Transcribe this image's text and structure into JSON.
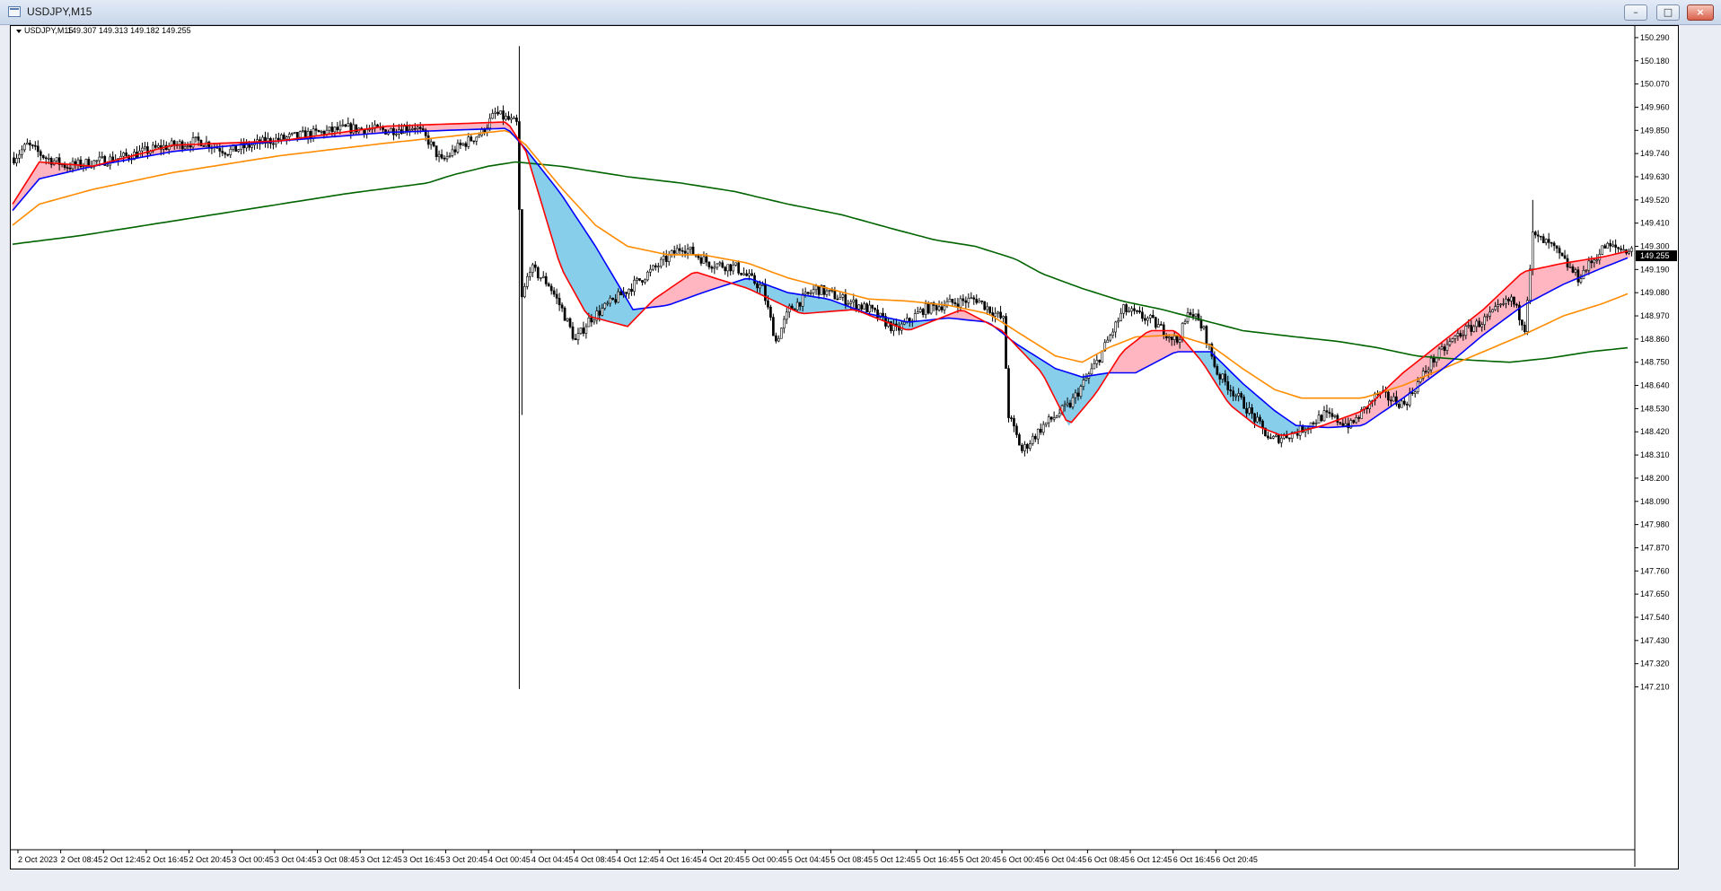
{
  "window": {
    "title": "USDJPY,M15",
    "buttons": {
      "minimize": "–",
      "maximize": "□",
      "close": "×"
    }
  },
  "chart_info": {
    "symbol_label": "USDJPY,M15",
    "ohlc": "149.307 149.313 149.182 149.255",
    "current_price": "149.255"
  },
  "colors": {
    "background": "#ffffff",
    "candle": "#000000",
    "ma_red": "#ff0000",
    "ma_blue": "#0000ff",
    "ma_orange": "#ff8c00",
    "ma_green": "#006400",
    "fill_bull": "#ffb6c1",
    "fill_bear": "#87ceeb"
  },
  "chart_data": {
    "type": "candlestick",
    "ylim": [
      147.11,
      150.345
    ],
    "y_ticks": [
      "150.290",
      "150.180",
      "150.070",
      "149.960",
      "149.850",
      "149.740",
      "149.630",
      "149.520",
      "149.410",
      "149.300",
      "149.190",
      "149.080",
      "148.970",
      "148.860",
      "148.750",
      "148.640",
      "148.530",
      "148.420",
      "148.310",
      "148.200",
      "148.090",
      "147.980",
      "147.870",
      "147.760",
      "147.650",
      "147.540",
      "147.430",
      "147.320",
      "147.210"
    ],
    "x_ticks": [
      "2 Oct 2023",
      "2 Oct 08:45",
      "2 Oct 12:45",
      "2 Oct 16:45",
      "2 Oct 20:45",
      "3 Oct 00:45",
      "3 Oct 04:45",
      "3 Oct 08:45",
      "3 Oct 12:45",
      "3 Oct 16:45",
      "3 Oct 20:45",
      "4 Oct 00:45",
      "4 Oct 04:45",
      "4 Oct 08:45",
      "4 Oct 12:45",
      "4 Oct 16:45",
      "4 Oct 20:45",
      "5 Oct 00:45",
      "5 Oct 04:45",
      "5 Oct 08:45",
      "5 Oct 12:45",
      "5 Oct 16:45",
      "5 Oct 20:45",
      "6 Oct 00:45",
      "6 Oct 04:45",
      "6 Oct 08:45",
      "6 Oct 12:45",
      "6 Oct 16:45",
      "6 Oct 20:45"
    ],
    "bars_per_tick": 16,
    "close_path": [
      [
        0,
        149.72
      ],
      [
        5,
        149.78
      ],
      [
        12,
        149.72
      ],
      [
        20,
        149.68
      ],
      [
        30,
        149.7
      ],
      [
        40,
        149.72
      ],
      [
        55,
        149.77
      ],
      [
        70,
        149.8
      ],
      [
        80,
        149.75
      ],
      [
        95,
        149.8
      ],
      [
        110,
        149.83
      ],
      [
        125,
        149.86
      ],
      [
        140,
        149.85
      ],
      [
        150,
        149.87
      ],
      [
        155,
        149.8
      ],
      [
        160,
        149.7
      ],
      [
        165,
        149.76
      ],
      [
        175,
        149.84
      ],
      [
        180,
        149.93
      ],
      [
        185,
        149.9
      ],
      [
        188,
        149.88
      ],
      [
        190,
        149.05
      ],
      [
        193,
        149.2
      ],
      [
        200,
        149.12
      ],
      [
        205,
        149.0
      ],
      [
        210,
        148.85
      ],
      [
        215,
        148.95
      ],
      [
        220,
        149.0
      ],
      [
        230,
        149.1
      ],
      [
        240,
        149.2
      ],
      [
        250,
        149.3
      ],
      [
        260,
        149.22
      ],
      [
        270,
        149.2
      ],
      [
        280,
        149.1
      ],
      [
        285,
        148.85
      ],
      [
        290,
        149.0
      ],
      [
        300,
        149.1
      ],
      [
        310,
        149.05
      ],
      [
        320,
        149.0
      ],
      [
        330,
        148.9
      ],
      [
        340,
        149.0
      ],
      [
        350,
        149.03
      ],
      [
        360,
        149.05
      ],
      [
        370,
        148.95
      ],
      [
        372,
        148.5
      ],
      [
        377,
        148.33
      ],
      [
        385,
        148.45
      ],
      [
        395,
        148.55
      ],
      [
        405,
        148.75
      ],
      [
        415,
        149.0
      ],
      [
        425,
        148.95
      ],
      [
        435,
        148.85
      ],
      [
        440,
        149.0
      ],
      [
        445,
        148.9
      ],
      [
        450,
        148.7
      ],
      [
        460,
        148.55
      ],
      [
        470,
        148.38
      ],
      [
        480,
        148.42
      ],
      [
        490,
        148.5
      ],
      [
        500,
        148.45
      ],
      [
        510,
        148.6
      ],
      [
        520,
        148.55
      ],
      [
        530,
        148.75
      ],
      [
        540,
        148.88
      ],
      [
        550,
        148.95
      ],
      [
        560,
        149.05
      ],
      [
        565,
        148.92
      ],
      [
        568,
        149.35
      ],
      [
        575,
        149.3
      ],
      [
        585,
        149.15
      ],
      [
        595,
        149.3
      ],
      [
        605,
        149.28
      ]
    ],
    "ma_red": [
      [
        0,
        149.5
      ],
      [
        10,
        149.7
      ],
      [
        30,
        149.68
      ],
      [
        60,
        149.78
      ],
      [
        100,
        149.8
      ],
      [
        140,
        149.87
      ],
      [
        185,
        149.89
      ],
      [
        192,
        149.75
      ],
      [
        205,
        149.2
      ],
      [
        215,
        148.97
      ],
      [
        230,
        148.92
      ],
      [
        240,
        149.05
      ],
      [
        255,
        149.18
      ],
      [
        275,
        149.1
      ],
      [
        295,
        148.98
      ],
      [
        315,
        149.0
      ],
      [
        335,
        148.9
      ],
      [
        355,
        149.0
      ],
      [
        370,
        148.9
      ],
      [
        385,
        148.7
      ],
      [
        395,
        148.45
      ],
      [
        405,
        148.6
      ],
      [
        415,
        148.8
      ],
      [
        425,
        148.9
      ],
      [
        435,
        148.9
      ],
      [
        445,
        148.75
      ],
      [
        455,
        148.55
      ],
      [
        465,
        148.45
      ],
      [
        475,
        148.4
      ],
      [
        490,
        148.45
      ],
      [
        505,
        148.52
      ],
      [
        520,
        148.7
      ],
      [
        535,
        148.85
      ],
      [
        550,
        149.0
      ],
      [
        565,
        149.18
      ],
      [
        580,
        149.22
      ],
      [
        595,
        149.25
      ],
      [
        605,
        149.28
      ]
    ],
    "ma_blue": [
      [
        0,
        149.47
      ],
      [
        10,
        149.62
      ],
      [
        30,
        149.68
      ],
      [
        60,
        149.75
      ],
      [
        100,
        149.8
      ],
      [
        140,
        149.84
      ],
      [
        185,
        149.86
      ],
      [
        192,
        149.76
      ],
      [
        205,
        149.55
      ],
      [
        218,
        149.3
      ],
      [
        232,
        149.0
      ],
      [
        245,
        149.02
      ],
      [
        258,
        149.08
      ],
      [
        275,
        149.15
      ],
      [
        290,
        149.08
      ],
      [
        305,
        149.05
      ],
      [
        320,
        148.98
      ],
      [
        335,
        148.94
      ],
      [
        350,
        148.96
      ],
      [
        365,
        148.94
      ],
      [
        375,
        148.84
      ],
      [
        390,
        148.72
      ],
      [
        400,
        148.68
      ],
      [
        410,
        148.7
      ],
      [
        420,
        148.7
      ],
      [
        435,
        148.8
      ],
      [
        448,
        148.8
      ],
      [
        460,
        148.65
      ],
      [
        472,
        148.52
      ],
      [
        480,
        148.45
      ],
      [
        492,
        148.44
      ],
      [
        505,
        148.45
      ],
      [
        520,
        148.58
      ],
      [
        535,
        148.72
      ],
      [
        550,
        148.88
      ],
      [
        565,
        149.02
      ],
      [
        580,
        149.12
      ],
      [
        595,
        149.2
      ],
      [
        605,
        149.25
      ]
    ],
    "ma_orange": [
      [
        0,
        149.4
      ],
      [
        10,
        149.5
      ],
      [
        30,
        149.57
      ],
      [
        60,
        149.65
      ],
      [
        100,
        149.73
      ],
      [
        140,
        149.79
      ],
      [
        185,
        149.85
      ],
      [
        192,
        149.78
      ],
      [
        205,
        149.58
      ],
      [
        218,
        149.4
      ],
      [
        230,
        149.3
      ],
      [
        245,
        149.26
      ],
      [
        258,
        149.26
      ],
      [
        275,
        149.22
      ],
      [
        290,
        149.15
      ],
      [
        305,
        149.1
      ],
      [
        320,
        149.05
      ],
      [
        335,
        149.04
      ],
      [
        350,
        149.02
      ],
      [
        365,
        148.98
      ],
      [
        375,
        148.9
      ],
      [
        390,
        148.78
      ],
      [
        400,
        148.75
      ],
      [
        410,
        148.82
      ],
      [
        420,
        148.87
      ],
      [
        435,
        148.88
      ],
      [
        448,
        148.83
      ],
      [
        460,
        148.72
      ],
      [
        472,
        148.62
      ],
      [
        482,
        148.58
      ],
      [
        495,
        148.58
      ],
      [
        505,
        148.58
      ],
      [
        520,
        148.64
      ],
      [
        535,
        148.72
      ],
      [
        550,
        148.8
      ],
      [
        565,
        148.88
      ],
      [
        580,
        148.97
      ],
      [
        595,
        149.03
      ],
      [
        605,
        149.08
      ]
    ],
    "ma_green": [
      [
        0,
        149.31
      ],
      [
        25,
        149.35
      ],
      [
        50,
        149.4
      ],
      [
        75,
        149.45
      ],
      [
        100,
        149.5
      ],
      [
        125,
        149.55
      ],
      [
        155,
        149.6
      ],
      [
        165,
        149.64
      ],
      [
        178,
        149.68
      ],
      [
        188,
        149.7
      ],
      [
        205,
        149.68
      ],
      [
        230,
        149.63
      ],
      [
        250,
        149.6
      ],
      [
        270,
        149.56
      ],
      [
        290,
        149.5
      ],
      [
        310,
        149.45
      ],
      [
        330,
        149.38
      ],
      [
        345,
        149.33
      ],
      [
        360,
        149.3
      ],
      [
        375,
        149.24
      ],
      [
        385,
        149.17
      ],
      [
        400,
        149.1
      ],
      [
        415,
        149.04
      ],
      [
        430,
        149.0
      ],
      [
        445,
        148.95
      ],
      [
        460,
        148.9
      ],
      [
        480,
        148.87
      ],
      [
        495,
        148.85
      ],
      [
        510,
        148.82
      ],
      [
        525,
        148.78
      ],
      [
        545,
        148.76
      ],
      [
        560,
        148.75
      ],
      [
        575,
        148.77
      ],
      [
        590,
        148.8
      ],
      [
        605,
        148.82
      ]
    ]
  }
}
